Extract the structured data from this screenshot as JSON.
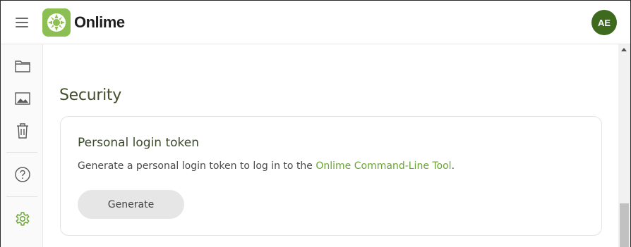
{
  "header": {
    "brand": "Onlime",
    "avatar_initials": "AE",
    "menu_icon": "hamburger-menu-icon"
  },
  "sidebar": {
    "items": [
      {
        "icon": "folder-icon"
      },
      {
        "icon": "image-icon"
      },
      {
        "icon": "trash-icon"
      },
      {
        "icon": "help-icon"
      },
      {
        "icon": "settings-icon",
        "active": true
      }
    ]
  },
  "main": {
    "section_title": "Security",
    "card": {
      "title": "Personal login token",
      "description_prefix": "Generate a personal login token to log in to the ",
      "link_text": "Onlime Command-Line Tool",
      "description_suffix": ".",
      "button_label": "Generate"
    }
  },
  "colors": {
    "brand_green": "#8cbf52",
    "avatar_bg": "#3d6a1d",
    "link": "#6aa534",
    "active_icon": "#6aa534"
  }
}
